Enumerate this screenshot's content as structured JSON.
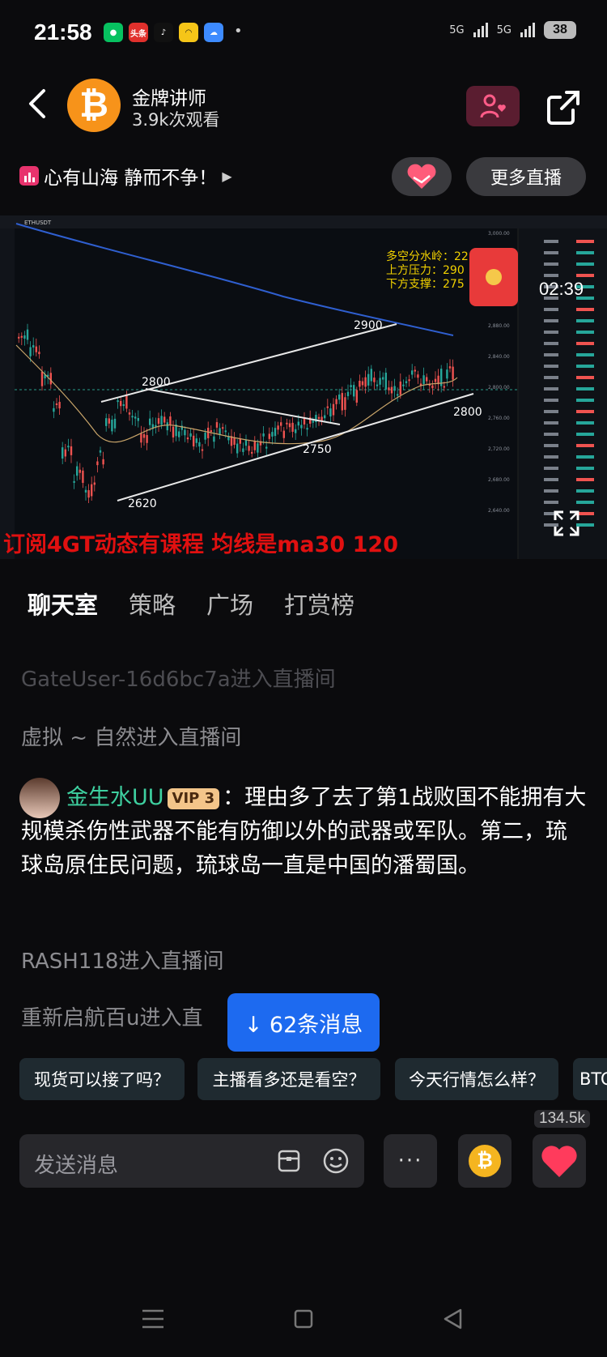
{
  "status": {
    "time": "21:58",
    "battery": "38",
    "signal1": "5G",
    "signal2": "5G"
  },
  "status_apps": [
    {
      "name": "wechat-icon",
      "text": "",
      "color": "#07c160"
    },
    {
      "name": "toutiao-icon",
      "text": "头条",
      "color": "#e0302c"
    },
    {
      "name": "tiktok-icon",
      "text": "♪",
      "color": "#111111"
    },
    {
      "name": "app-icon",
      "text": "",
      "color": "#f5c518"
    },
    {
      "name": "weather-icon",
      "text": "",
      "color": "#3d8bff"
    }
  ],
  "header": {
    "host_name": "金牌讲师",
    "views": "3.9k次观看"
  },
  "slogan": "心有山海 静而不争！",
  "more_live": "更多直播",
  "stream": {
    "timer": "02:39",
    "overlay_caption": "订阅4GT动态有课程   均线是ma30 120",
    "ticker": "ETHUSDT",
    "annotations": [
      "多空分水岭：22",
      "上方压力：290",
      "下方支撑：275"
    ],
    "level_labels": [
      "2900",
      "2800",
      "2800",
      "2750",
      "2620"
    ],
    "price_ticks": [
      "3,000.00",
      "2,960.00",
      "2,920.00",
      "2,880.00",
      "2,840.00",
      "2,800.00",
      "2,760.00",
      "2,720.00",
      "2,680.00",
      "2,640.00"
    ]
  },
  "tabs": [
    "聊天室",
    "策略",
    "广场",
    "打赏榜"
  ],
  "chat": {
    "faded_line": "GateUser-16d6bc7a进入直播间",
    "line1": "虚拟 ~ 自然进入直播间",
    "message": {
      "user": "金生水UU",
      "vip": "VIP 3",
      "text": "：理由多了去了第1战败国不能拥有大规模杀伤性武器不能有防御以外的武器或军队。第二，琉球岛原住民问题，琉球岛一直是中国的潘蜀国。"
    },
    "line2": "RASH118进入直播间",
    "line3": "重新启航百u进入直"
  },
  "new_messages": "↓ 62条消息",
  "quick_replies": [
    "现货可以接了吗？",
    "主播看多还是看空？",
    "今天行情怎么样？",
    "BTC"
  ],
  "input_placeholder": "发送消息",
  "likes_count": "134.5k",
  "colors": {
    "accent": "#1d6af0",
    "like": "#ff3b5c",
    "vip": "#f3c58a",
    "username": "#3ed0a0",
    "caption": "#e01010"
  }
}
